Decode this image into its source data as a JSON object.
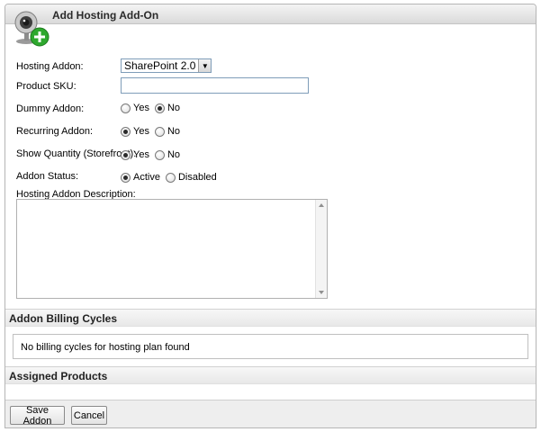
{
  "header": {
    "title": "Add Hosting Add-On",
    "icon": "webcam-add-icon"
  },
  "form": {
    "hosting_addon": {
      "label": "Hosting Addon:",
      "value": "SharePoint 2.0"
    },
    "product_sku": {
      "label": "Product SKU:",
      "value": ""
    },
    "dummy_addon": {
      "label": "Dummy Addon:",
      "options": [
        "Yes",
        "No"
      ],
      "selected": "No"
    },
    "recurring_addon": {
      "label": "Recurring Addon:",
      "options": [
        "Yes",
        "No"
      ],
      "selected": "Yes"
    },
    "show_quantity": {
      "label": "Show Quantity (Storefront):",
      "options": [
        "Yes",
        "No"
      ],
      "selected": "Yes"
    },
    "addon_status": {
      "label": "Addon Status:",
      "options": [
        "Active",
        "Disabled"
      ],
      "selected": "Active"
    },
    "description": {
      "label": "Hosting Addon Description:",
      "value": ""
    }
  },
  "billing": {
    "title": "Addon Billing Cycles",
    "empty_text": "No billing cycles for hosting plan found"
  },
  "assigned": {
    "title": "Assigned Products"
  },
  "footer": {
    "save_label": "Save Addon",
    "cancel_label": "Cancel"
  },
  "colors": {
    "accent_green": "#2ea82e",
    "header_bg": "#dadada",
    "border": "#b5b5b5"
  }
}
